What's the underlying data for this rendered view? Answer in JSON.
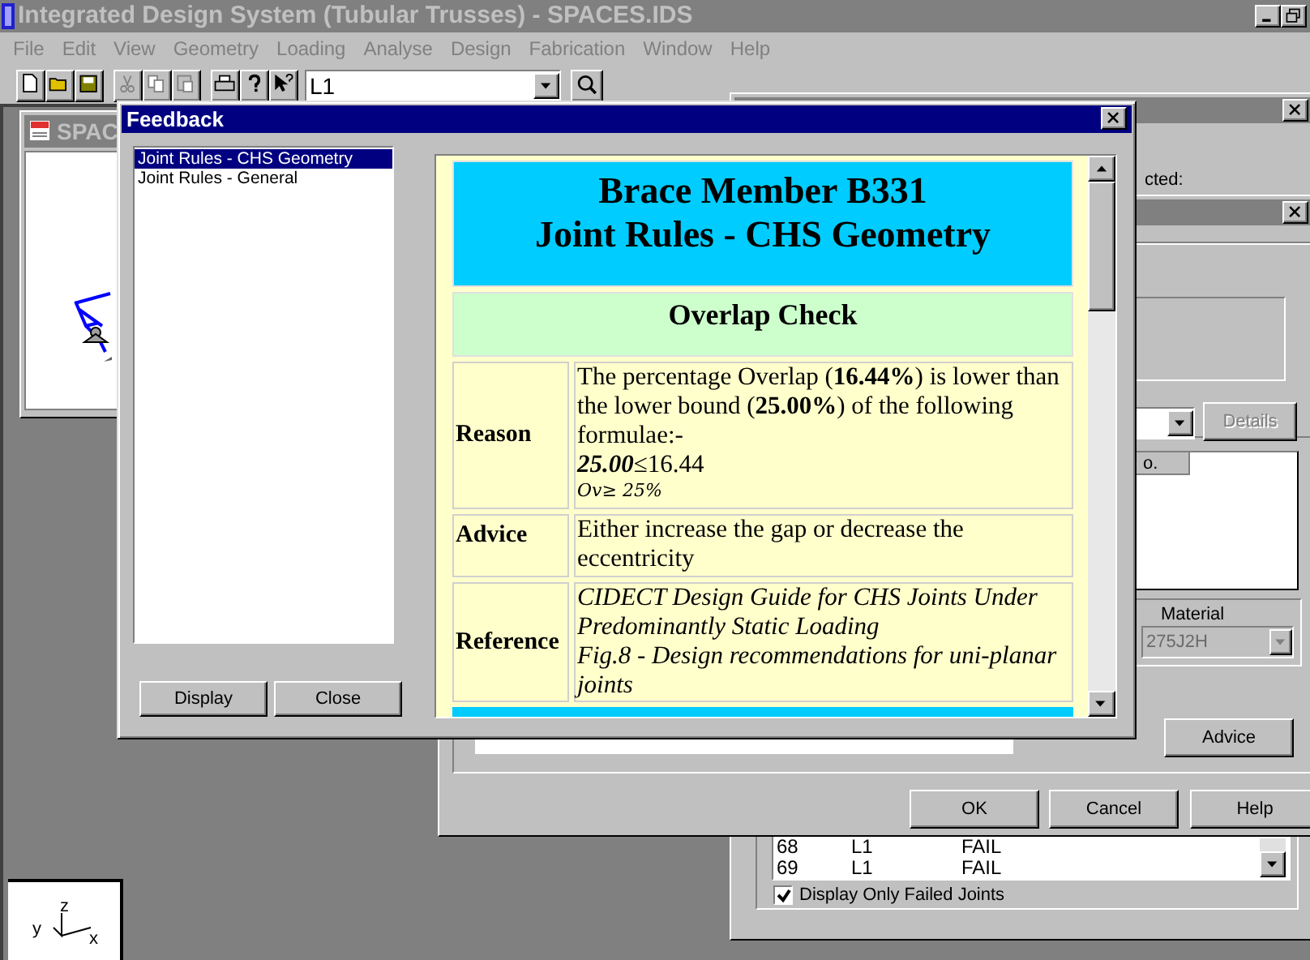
{
  "app": {
    "title": "Integrated Design System (Tubular Trusses) - SPACES.IDS",
    "menu": [
      "File",
      "Edit",
      "View",
      "Geometry",
      "Loading",
      "Analyse",
      "Design",
      "Fabrication",
      "Window",
      "Help"
    ],
    "load_case": {
      "value": "L1"
    }
  },
  "child_window": {
    "title": "SPAC"
  },
  "results_window": {
    "label": "cted:",
    "results": [
      {
        "joint": "68",
        "load_case": "L1",
        "status": "FAIL"
      },
      {
        "joint": "69",
        "load_case": "L1",
        "status": "FAIL"
      }
    ],
    "failed_only": {
      "label": "Display Only Failed Joints",
      "checked": true
    }
  },
  "design_dialog": {
    "column_header": "o.",
    "details_button": {
      "label": "Details",
      "disabled": true
    },
    "material": {
      "label": "Material",
      "value": "275J2H",
      "disabled": true
    },
    "advice_button": "Advice",
    "buttons": [
      "OK",
      "Cancel",
      "Help"
    ]
  },
  "feedback": {
    "title": "Feedback",
    "rules": [
      {
        "label": "Joint Rules - CHS Geometry",
        "selected": true
      },
      {
        "label": "Joint Rules - General",
        "selected": false
      }
    ],
    "buttons": [
      "Display",
      "Close"
    ],
    "report": {
      "heading": [
        "Brace Member B331",
        "Joint Rules - CHS Geometry"
      ],
      "check": "Overlap Check",
      "rows": [
        {
          "kind": "reason",
          "label": "Reason",
          "text": "The percentage Overlap (**16.44%**) is lower than the lower bound (**25.00%**) of the following formulae:-",
          "formula": "**25.00**≤16.44",
          "condition": "Ov≥ 25%"
        },
        {
          "kind": "advice",
          "label": "Advice",
          "text": "Either increase the gap or decrease the eccentricity"
        },
        {
          "kind": "reference",
          "label": "Reference",
          "lines": [
            "CIDECT Design Guide for CHS Joints Under Predominantly Static Loading",
            "Fig.8 - Design recommendations for uni-planar joints"
          ]
        }
      ]
    }
  },
  "axes": {
    "labels": [
      "z",
      "y",
      "x"
    ]
  }
}
